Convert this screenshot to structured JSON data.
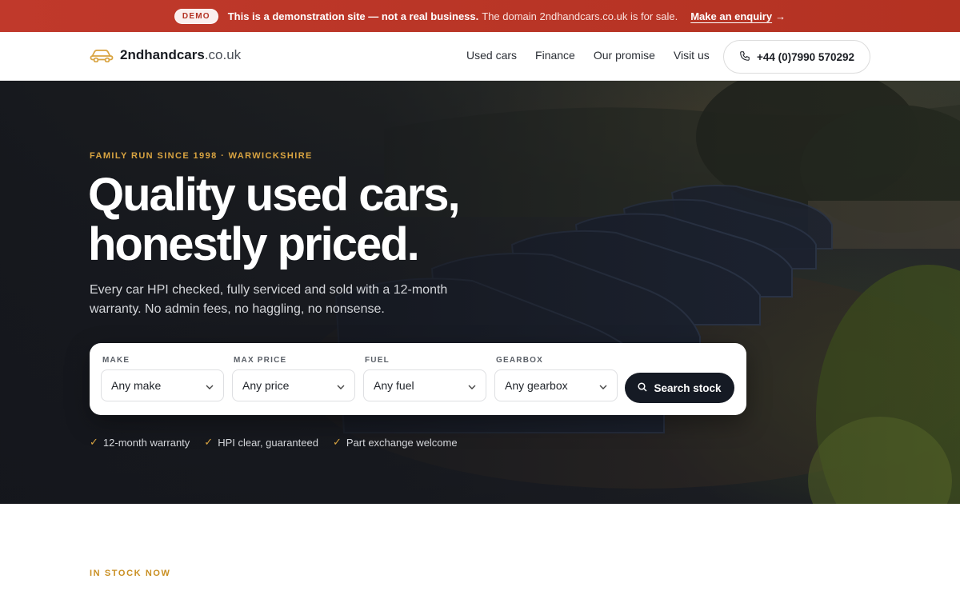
{
  "banner": {
    "badge": "DEMO",
    "strong_text": "This is a demonstration site — not a real business.",
    "rest_text": "The domain 2ndhandcars.co.uk is for sale.",
    "cta_label": "Make an enquiry",
    "cta_arrow": "→"
  },
  "nav": {
    "logo_name": "2ndhandcars",
    "logo_tld": ".co.uk",
    "links": [
      "Used cars",
      "Finance",
      "Our promise",
      "Visit us"
    ],
    "phone": "+44 (0)7990 570292"
  },
  "hero": {
    "eyebrow": "FAMILY RUN SINCE 1998 · WARWICKSHIRE",
    "headline_line1": "Quality used cars,",
    "headline_line2": "honestly priced.",
    "subtext": "Every car HPI checked, fully serviced and sold with a 12-month warranty. No admin fees, no haggling, no nonsense."
  },
  "search": {
    "fields": [
      {
        "label": "MAKE",
        "value": "Any make"
      },
      {
        "label": "MAX PRICE",
        "value": "Any price"
      },
      {
        "label": "FUEL",
        "value": "Any fuel"
      },
      {
        "label": "GEARBOX",
        "value": "Any gearbox"
      }
    ],
    "button_label": "Search stock"
  },
  "ticks": [
    "12-month warranty",
    "HPI clear, guaranteed",
    "Part exchange welcome"
  ],
  "stock": {
    "eyebrow": "IN STOCK NOW"
  },
  "colors": {
    "banner": "#c0392b",
    "accent": "#d9a441",
    "button_dark": "#151a24"
  }
}
